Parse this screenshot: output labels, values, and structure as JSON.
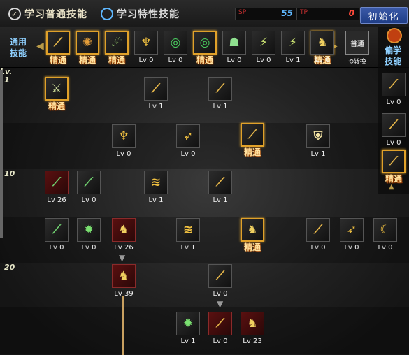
{
  "tabs": {
    "normal": "学习普通技能",
    "special": "学习特性技能"
  },
  "sp": {
    "sp_label": "SP",
    "sp_value": "55",
    "tp_label": "TP",
    "tp_value": "0"
  },
  "reset": "初始化",
  "quick": {
    "left_label": [
      "通用",
      "技能"
    ],
    "convert_top": "普通",
    "convert_bottom": "⟲转换"
  },
  "right": {
    "label": [
      "偏学",
      "技能"
    ]
  },
  "levels": [
    "1",
    "10",
    "20"
  ],
  "lv_tag": "Lv.",
  "colors": {
    "gold": "#e0a12a",
    "blue": "#5fb8ff"
  },
  "quick_skills": [
    {
      "lv": "精通",
      "icon": "slash"
    },
    {
      "lv": "精通",
      "icon": "swirl"
    },
    {
      "lv": "精通",
      "icon": "leap"
    },
    {
      "lv": "Lv 0",
      "icon": "wing"
    },
    {
      "lv": "Lv 0",
      "icon": "target"
    },
    {
      "lv": "精通",
      "icon": "target"
    },
    {
      "lv": "Lv 0",
      "icon": "guard"
    },
    {
      "lv": "Lv 0",
      "icon": "kick"
    },
    {
      "lv": "Lv 1",
      "icon": "kick"
    },
    {
      "lv": "精通",
      "icon": "eye"
    },
    {
      "lv": "Lv 0",
      "icon": "body"
    }
  ],
  "side_skills": [
    {
      "lv": "Lv 0"
    },
    {
      "lv": "Lv 0"
    },
    {
      "lv": "精通"
    }
  ],
  "grid": [
    {
      "lv": "精通",
      "icon": "sword"
    },
    {
      "lv": "Lv 1",
      "icon": "slash"
    },
    {
      "lv": "Lv 1",
      "icon": "slash"
    },
    {
      "lv": "Lv 0",
      "icon": "wing"
    },
    {
      "lv": "Lv 0",
      "icon": "arrow"
    },
    {
      "lv": "精通",
      "icon": "slash"
    },
    {
      "lv": "Lv 1",
      "icon": "shield"
    },
    {
      "lv": "Lv 26",
      "icon": "blade"
    },
    {
      "lv": "Lv 0",
      "icon": "blade"
    },
    {
      "lv": "Lv 1",
      "icon": "wave"
    },
    {
      "lv": "Lv 1",
      "icon": "slash"
    },
    {
      "lv": "Lv 0",
      "icon": "blade"
    },
    {
      "lv": "Lv 0",
      "icon": "burst"
    },
    {
      "lv": "Lv 26",
      "icon": "body"
    },
    {
      "lv": "Lv 1",
      "icon": "wave"
    },
    {
      "lv": "精通",
      "icon": "body"
    },
    {
      "lv": "Lv 0",
      "icon": "slash"
    },
    {
      "lv": "Lv 0",
      "icon": "arrow"
    },
    {
      "lv": "Lv 0",
      "icon": "moon"
    },
    {
      "lv": "Lv 39",
      "icon": "body"
    },
    {
      "lv": "Lv 0",
      "icon": "slash"
    },
    {
      "lv": "Lv 1",
      "icon": "burst"
    },
    {
      "lv": "Lv 0",
      "icon": "slash"
    },
    {
      "lv": "Lv 23",
      "icon": "body"
    }
  ]
}
